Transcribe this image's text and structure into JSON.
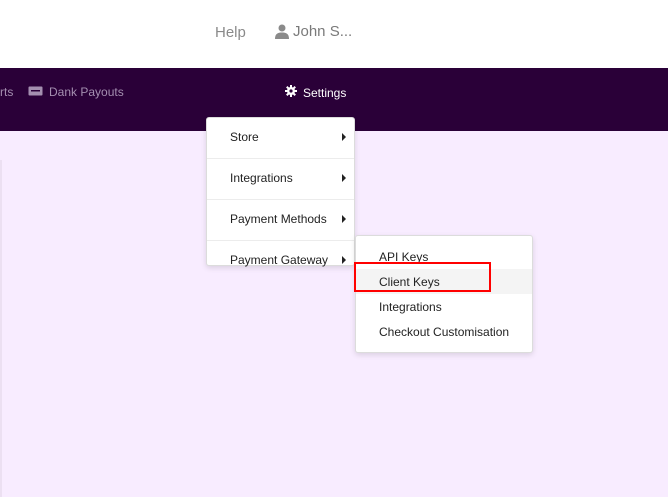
{
  "header": {
    "help_label": "Help",
    "user_name": "John S...",
    "user_icon": "person-icon"
  },
  "nav": {
    "partial_label": "rts",
    "bank_payouts_label": "Dank Payouts",
    "bank_payouts_icon": "card-icon",
    "settings_label": "Settings",
    "settings_icon": "gear-icon"
  },
  "settings_menu": {
    "items": [
      {
        "label": "Store"
      },
      {
        "label": "Integrations"
      },
      {
        "label": "Payment Methods"
      },
      {
        "label": "Payment Gateway"
      }
    ]
  },
  "payment_gateway_submenu": {
    "items": [
      {
        "label": "API Keys"
      },
      {
        "label": "Client Keys"
      },
      {
        "label": "Integrations"
      },
      {
        "label": "Checkout Customisation"
      }
    ],
    "highlighted": "Client Keys",
    "highlight_color": "#ff0000"
  },
  "colors": {
    "navbar_bg": "#2a0038",
    "content_bg": "#f8ecff"
  }
}
